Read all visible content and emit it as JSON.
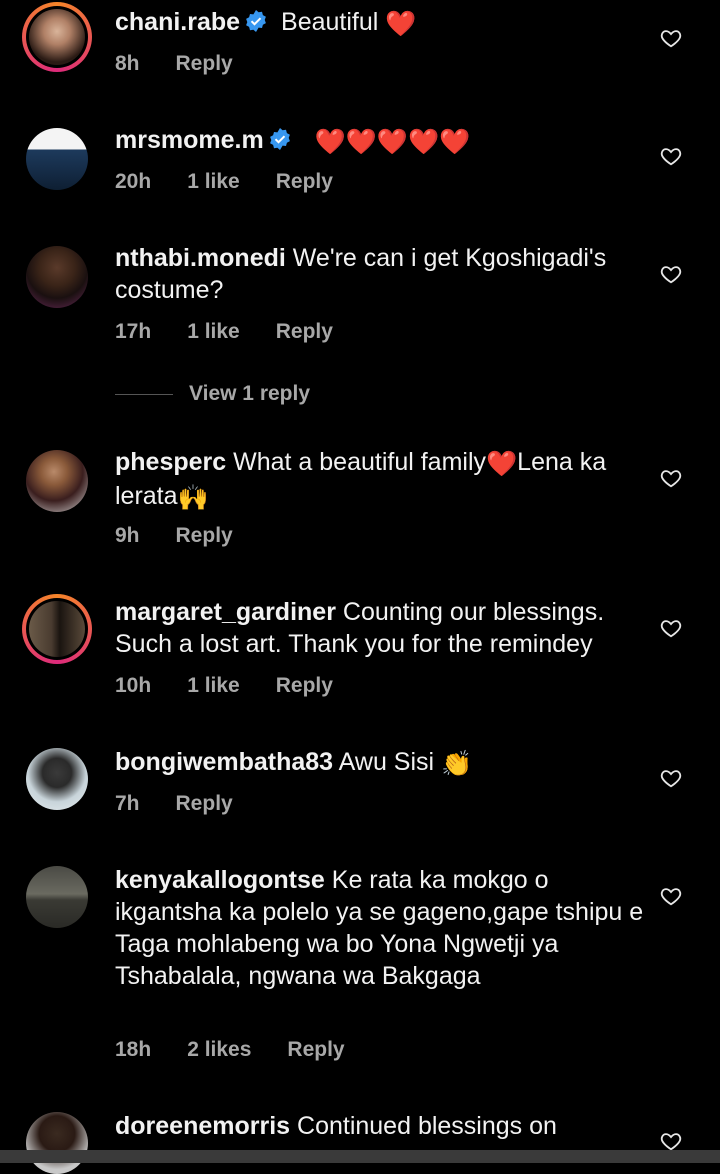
{
  "comments": [
    {
      "user": "chani.rabe",
      "verified": true,
      "text": "Beautiful",
      "emoji": "❤️",
      "time": "8h",
      "likes": "",
      "reply": "Reply",
      "ring": true
    },
    {
      "user": "mrsmome.m",
      "verified": true,
      "text": "",
      "emoji": "❤️❤️❤️❤️❤️",
      "time": "20h",
      "likes": "1 like",
      "reply": "Reply",
      "ring": false
    },
    {
      "user": "nthabi.monedi",
      "verified": false,
      "text": "We're can i get Kgoshigadi's costume?",
      "emoji": "",
      "time": "17h",
      "likes": "1 like",
      "reply": "Reply",
      "ring": false
    },
    {
      "user": "phesperc",
      "verified": false,
      "text": "What a beautiful family",
      "emoji": "❤️",
      "text2": "Lena ka lerata",
      "emoji2": "🙌",
      "time": "9h",
      "likes": "",
      "reply": "Reply",
      "ring": false
    },
    {
      "user": "margaret_gardiner",
      "verified": false,
      "text": "Counting our blessings. Such a lost art. Thank you for the remindey",
      "emoji": "",
      "time": "10h",
      "likes": "1 like",
      "reply": "Reply",
      "ring": true
    },
    {
      "user": "bongiwembatha83",
      "verified": false,
      "text": "Awu Sisi",
      "emoji": "👏",
      "time": "7h",
      "likes": "",
      "reply": "Reply",
      "ring": false
    },
    {
      "user": "kenyakallogontse",
      "verified": false,
      "text": "Ke rata ka mokgo o ikgantsha ka polelo ya se gageno,gape tshipu e Taga mohlabeng wa bo Yona Ngwetji ya Tshabalala, ngwana wa Bakgaga",
      "emoji": "",
      "time": "18h",
      "likes": "2 likes",
      "reply": "Reply",
      "ring": false
    },
    {
      "user": "doreenemorris",
      "verified": false,
      "text": "Continued blessings on",
      "emoji": "",
      "time": "",
      "likes": "",
      "reply": "",
      "ring": false
    }
  ],
  "view_replies": "View 1 reply",
  "colors": {
    "verified": "#3797f0",
    "heart_red": "#ed1c24",
    "meta": "#a8a8a8"
  }
}
